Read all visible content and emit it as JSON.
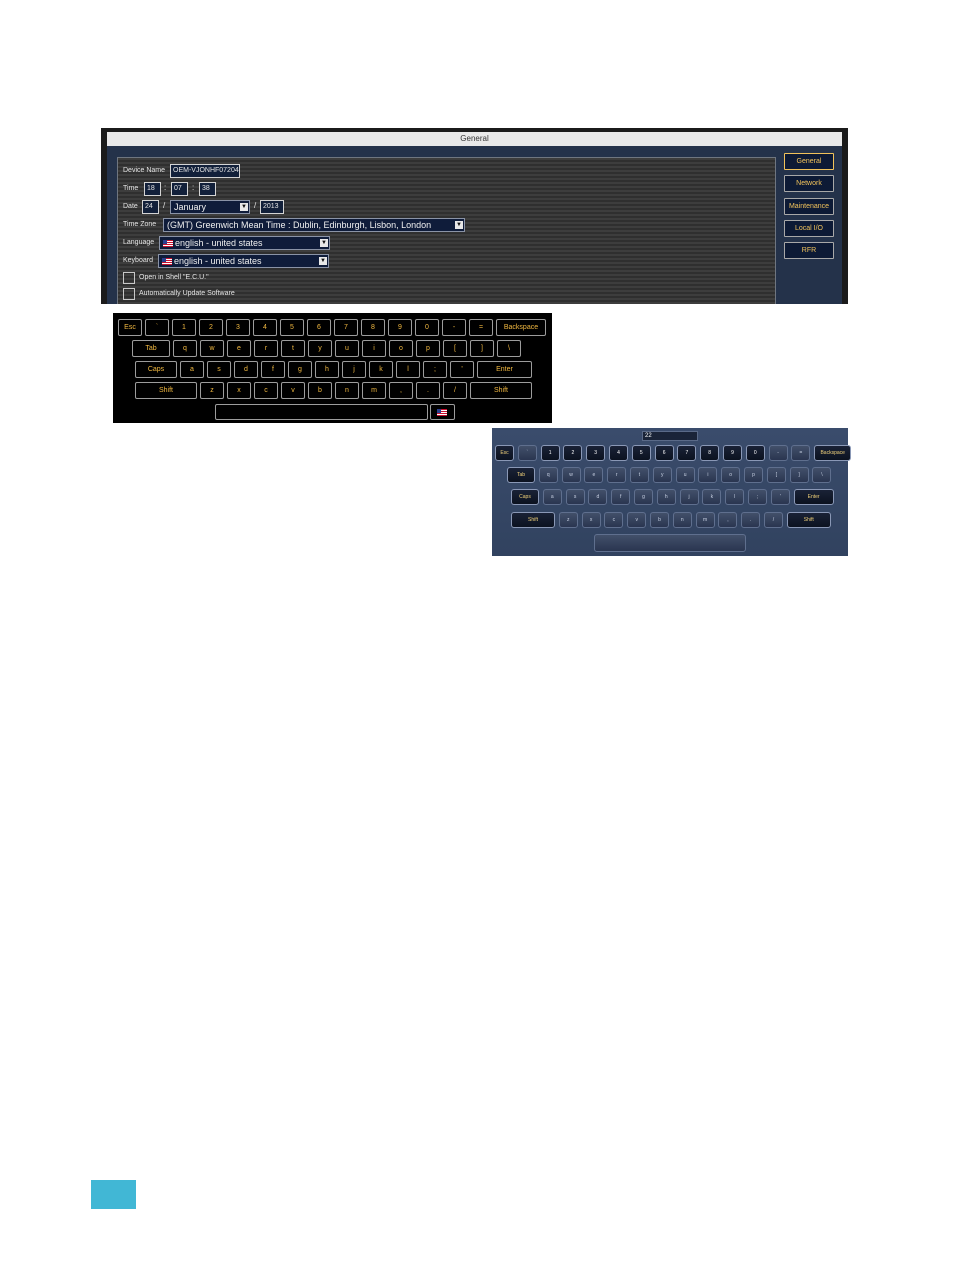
{
  "window": {
    "title": "General",
    "form": {
      "device_name_label": "Device Name",
      "device_name": "OEM-VJONHF07204",
      "time_label": "Time",
      "time_hour": "18",
      "time_minute": "07",
      "time_second": "38",
      "time_sep": ":",
      "date_label": "Date",
      "date_day": "24",
      "date_month": "January",
      "date_year": "2013",
      "date_sep": "/",
      "timezone_label": "Time Zone",
      "timezone": "(GMT) Greenwich Mean Time : Dublin, Edinburgh, Lisbon, London",
      "language_label": "Language",
      "language": "english - united states",
      "keyboard_label": "Keyboard",
      "keyboard": "english - united states",
      "open_in_shell_label": "Open in Shell \"E.C.U.\"",
      "open_in_shell_checked": false,
      "auto_update_label": "Automatically Update Software",
      "auto_update_checked": false
    },
    "side_tabs": [
      {
        "label": "General",
        "active": true
      },
      {
        "label": "Network",
        "active": false
      },
      {
        "label": "Maintenance",
        "active": false
      },
      {
        "label": "Local I/O",
        "active": false
      },
      {
        "label": "RFR",
        "active": false
      }
    ]
  },
  "keyboard_black": {
    "rows": [
      [
        "Esc",
        "`",
        "1",
        "2",
        "3",
        "4",
        "5",
        "6",
        "7",
        "8",
        "9",
        "0",
        "-",
        "=",
        "Backspace"
      ],
      [
        "Tab",
        "q",
        "w",
        "e",
        "r",
        "t",
        "y",
        "u",
        "i",
        "o",
        "p",
        "[",
        "]",
        "\\"
      ],
      [
        "Caps",
        "a",
        "s",
        "d",
        "f",
        "g",
        "h",
        "j",
        "k",
        "l",
        ";",
        "'",
        "Enter"
      ],
      [
        "Shift",
        "z",
        "x",
        "c",
        "v",
        "b",
        "n",
        "m",
        ",",
        ".",
        "/",
        "Shift"
      ]
    ],
    "flag_icon": "us-flag-icon",
    "key_text_color": "#f2b941"
  },
  "keyboard_blue": {
    "input_value": "22",
    "rows": [
      [
        "Esc",
        "`",
        "1",
        "2",
        "3",
        "4",
        "5",
        "6",
        "7",
        "8",
        "9",
        "0",
        "-",
        "=",
        "Backspace"
      ],
      [
        "Tab",
        "q",
        "w",
        "e",
        "r",
        "t",
        "y",
        "u",
        "i",
        "o",
        "p",
        "[",
        "]",
        "\\"
      ],
      [
        "Caps",
        "a",
        "s",
        "d",
        "f",
        "g",
        "h",
        "j",
        "k",
        "l",
        ";",
        "'",
        "Enter"
      ],
      [
        "Shift",
        "z",
        "x",
        "c",
        "v",
        "b",
        "n",
        "m",
        ",",
        ".",
        "/",
        "Shift"
      ]
    ],
    "active_keys": [
      "1",
      "2",
      "3",
      "4",
      "5",
      "6",
      "7",
      "8",
      "9",
      "0"
    ]
  },
  "colors": {
    "accent_gold": "#f1c25a",
    "page_tab": "#41b7d5"
  }
}
